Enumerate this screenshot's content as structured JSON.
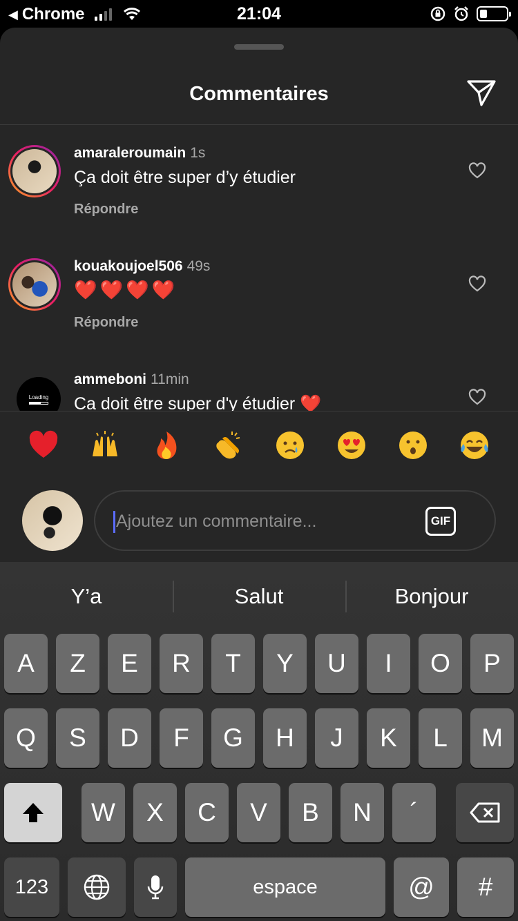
{
  "status_bar": {
    "back_label": "Chrome",
    "time": "21:04"
  },
  "sheet": {
    "title": "Commentaires"
  },
  "comments": [
    {
      "username": "amaraleroumain",
      "time": "1s",
      "text": "Ça doit être super d’y étudier",
      "reply_label": "Répondre"
    },
    {
      "username": "kouakoujoel506",
      "time": "49s",
      "text": "❤️❤️❤️❤️",
      "reply_label": "Répondre"
    },
    {
      "username": "ammeboni",
      "time": "11min",
      "text": "Ca doit être super d'y étudier ❤️",
      "reply_label": "",
      "avatar_text": "Loading"
    }
  ],
  "quick_reactions": [
    "red-heart",
    "raised-hands",
    "fire",
    "clapping-hands",
    "crying-face",
    "heart-eyes-face",
    "astonished-face",
    "tears-of-joy-face"
  ],
  "composer": {
    "placeholder": "Ajoutez un commentaire...",
    "gif_label": "GIF"
  },
  "keyboard": {
    "suggestions": [
      "Y’a",
      "Salut",
      "Bonjour"
    ],
    "row1": [
      "A",
      "Z",
      "E",
      "R",
      "T",
      "Y",
      "U",
      "I",
      "O",
      "P"
    ],
    "row2": [
      "Q",
      "S",
      "D",
      "F",
      "G",
      "H",
      "J",
      "K",
      "L",
      "M"
    ],
    "row3": [
      "W",
      "X",
      "C",
      "V",
      "B",
      "N",
      "´"
    ],
    "numbers_label": "123",
    "space_label": "espace",
    "at_label": "@",
    "hash_label": "#"
  },
  "colors": {
    "sheet_bg": "#262626",
    "accent_caret": "#5b6cff",
    "secondary_text": "#a8a8a8"
  }
}
